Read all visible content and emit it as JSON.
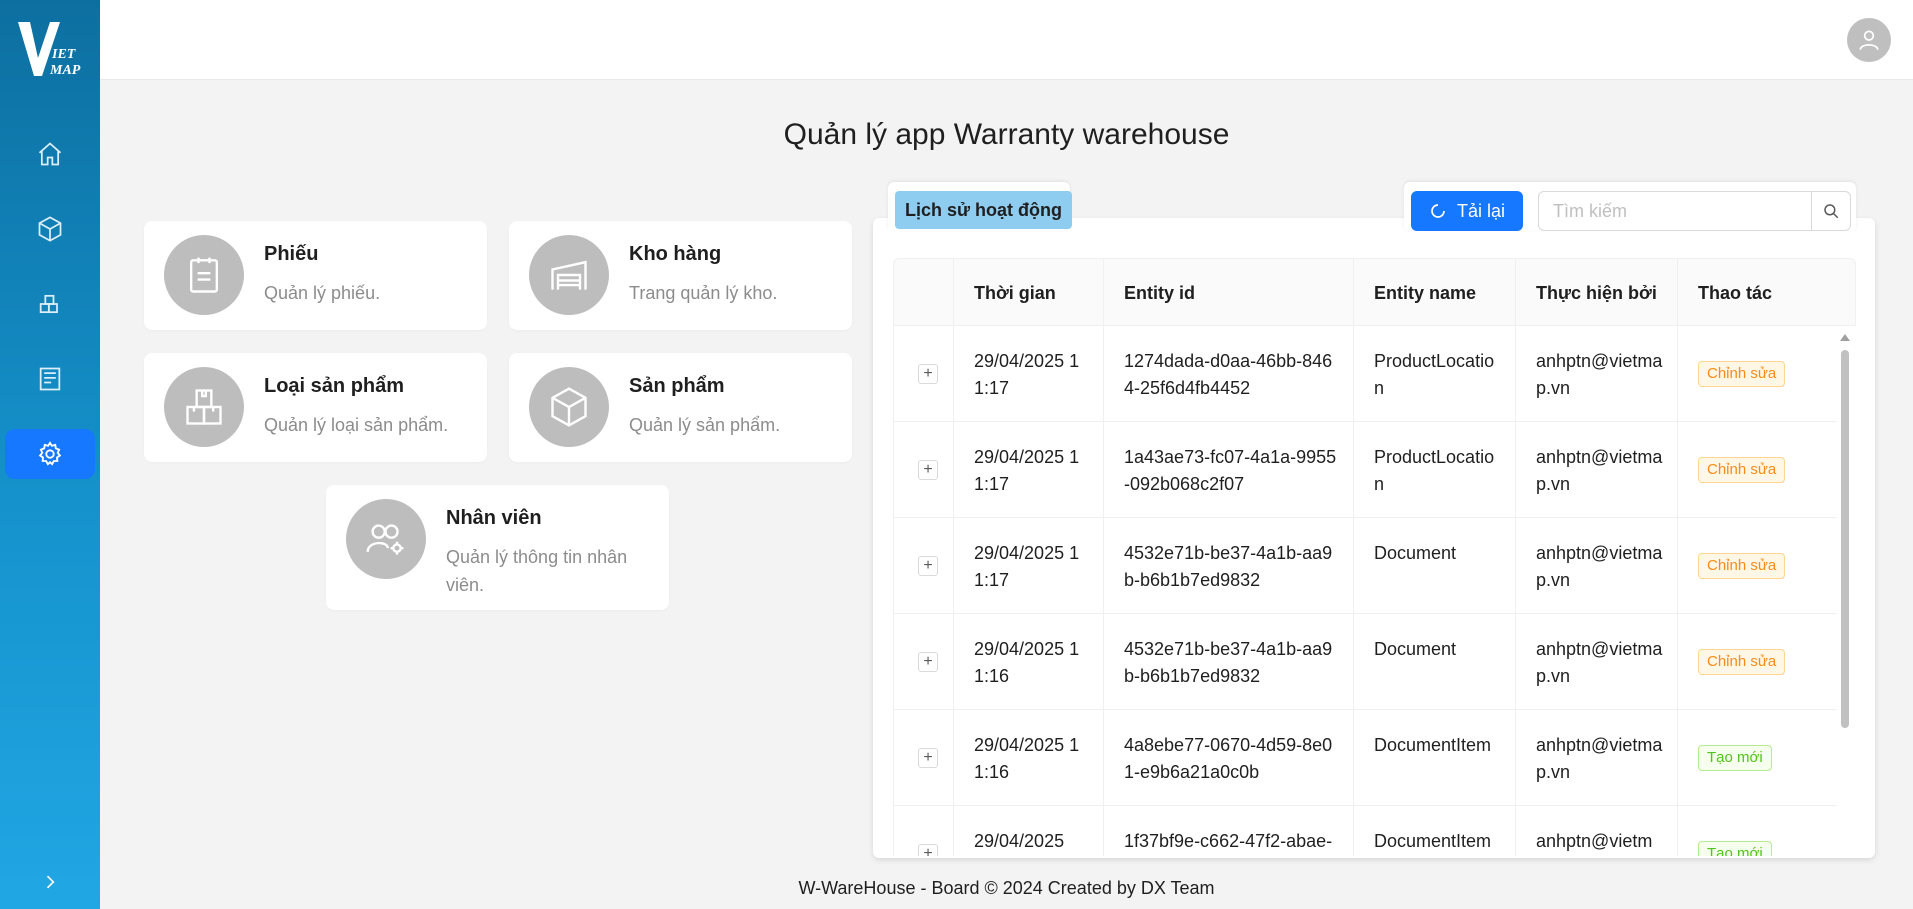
{
  "logo": {
    "alt": "VietMap"
  },
  "title": "Quản lý app Warranty warehouse",
  "cards": [
    {
      "title": "Phiếu",
      "desc": "Quản lý phiếu.",
      "icon": "clipboard-icon"
    },
    {
      "title": "Kho hàng",
      "desc": "Trang quản lý kho.",
      "icon": "warehouse-icon"
    },
    {
      "title": "Loại sản phẩm",
      "desc": "Quản lý loại sản phẩm.",
      "icon": "product-type-icon"
    },
    {
      "title": "Sản phẩm",
      "desc": "Quản lý sản phẩm.",
      "icon": "box-icon"
    },
    {
      "title": "Nhân viên",
      "desc": "Quản lý thông tin nhân viên.",
      "icon": "team-settings-icon"
    }
  ],
  "activity": {
    "tab_label": "Lịch sử hoạt động",
    "reload_label": "Tải lại",
    "search_placeholder": "Tìm kiếm",
    "columns": [
      "Thời gian",
      "Entity id",
      "Entity name",
      "Thực hiện bởi",
      "Thao tác"
    ],
    "rows": [
      {
        "time": "29/04/2025 11:17",
        "entity_id": "1274dada-d0aa-46bb-8464-25f6d4fb4452",
        "entity_name": "ProductLocation",
        "by": "anhptn@vietmap.vn",
        "action": "Chỉnh sửa",
        "type": "edit"
      },
      {
        "time": "29/04/2025 11:17",
        "entity_id": "1a43ae73-fc07-4a1a-9955-092b068c2f07",
        "entity_name": "ProductLocation",
        "by": "anhptn@vietmap.vn",
        "action": "Chỉnh sửa",
        "type": "edit"
      },
      {
        "time": "29/04/2025 11:17",
        "entity_id": "4532e71b-be37-4a1b-aa9b-b6b1b7ed9832",
        "entity_name": "Document",
        "by": "anhptn@vietmap.vn",
        "action": "Chỉnh sửa",
        "type": "edit"
      },
      {
        "time": "29/04/2025 11:16",
        "entity_id": "4532e71b-be37-4a1b-aa9b-b6b1b7ed9832",
        "entity_name": "Document",
        "by": "anhptn@vietmap.vn",
        "action": "Chỉnh sửa",
        "type": "edit"
      },
      {
        "time": "29/04/2025 11:16",
        "entity_id": "4a8ebe77-0670-4d59-8e01-e9b6a21a0c0b",
        "entity_name": "DocumentItem",
        "by": "anhptn@vietmap.vn",
        "action": "Tạo mới",
        "type": "new"
      },
      {
        "time": "29/04/2025",
        "entity_id": "1f37bf9e-c662-47f2-abae-",
        "entity_name": "DocumentItem",
        "by": "anhptn@vietm",
        "action": "Tạo mới",
        "type": "new"
      }
    ]
  },
  "footer": "W-WareHouse - Board © 2024 Created by DX Team",
  "colors": {
    "primary": "#1677ff",
    "sidebar_top": "#0d6fa0",
    "sidebar_bottom": "#21a7e4",
    "tab": "#8fcdf0"
  }
}
